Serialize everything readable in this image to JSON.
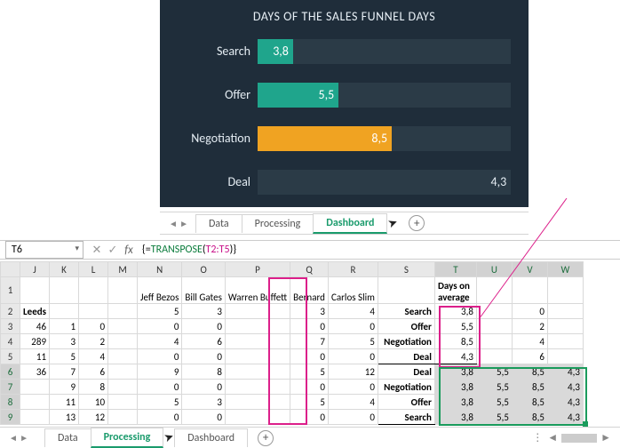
{
  "chart_data": {
    "type": "bar",
    "title": "DAYS OF THE SALES FUNNEL DAYS",
    "categories": [
      "Search",
      "Offer",
      "Negotiation",
      "Deal"
    ],
    "values": [
      3.8,
      5.5,
      8.5,
      4.3
    ],
    "value_labels": [
      "3,8",
      "5,5",
      "8,5",
      "4,3"
    ],
    "colors": [
      "#1fa58c",
      "#1fa58c",
      "#f0a322",
      "#2b3b47"
    ],
    "bar_width_pct": [
      14,
      32,
      53,
      100
    ],
    "value_outside": [
      false,
      false,
      false,
      true
    ],
    "xlabel": "",
    "ylabel": ""
  },
  "tabs": {
    "t1": "Data",
    "t2": "Processing",
    "t3": "Dashboard",
    "plus": "+"
  },
  "formula_bar": {
    "name_box": "T6",
    "cancel": "✕",
    "confirm": "✓",
    "fx": "fx",
    "prefix": "{=",
    "fn": "TRANSPOSE",
    "open": "(",
    "range": "T2:T5",
    "close": ")}"
  },
  "headers": {
    "J": "J",
    "K": "K",
    "L": "L",
    "M": "M",
    "N": "N",
    "O": "O",
    "P": "P",
    "Q": "Q",
    "R": "R",
    "S": "S",
    "T": "T",
    "U": "U",
    "V": "V",
    "W": "W"
  },
  "row_labels": [
    "1",
    "2",
    "3",
    "4",
    "5",
    "6",
    "7",
    "8",
    "9"
  ],
  "row1": {
    "N": "Jeff Bezos",
    "O": "Bill Gates",
    "P": "Warren Buffett",
    "Q": "Bernard",
    "R": "Carlos Slim",
    "T": "Days on average"
  },
  "row2": {
    "J": "Leeds",
    "N": "5",
    "O": "3",
    "Q": "3",
    "R": "4",
    "S": "Search",
    "T": "3,8",
    "V": "0"
  },
  "row3": {
    "J": "46",
    "K": "1",
    "L": "0",
    "N": "0",
    "O": "0",
    "Q": "0",
    "R": "0",
    "S": "Offer",
    "T": "5,5",
    "V": "2"
  },
  "row4": {
    "J": "289",
    "K": "3",
    "L": "2",
    "N": "4",
    "O": "6",
    "Q": "7",
    "R": "5",
    "S": "Negotiation",
    "T": "8,5",
    "V": "4"
  },
  "row5": {
    "J": "11",
    "K": "5",
    "L": "4",
    "N": "0",
    "O": "0",
    "Q": "0",
    "R": "0",
    "S": "Deal",
    "T": "4,3",
    "V": "6"
  },
  "row6": {
    "J": "36",
    "K": "7",
    "L": "6",
    "N": "9",
    "O": "8",
    "Q": "5",
    "R": "12",
    "S": "Deal",
    "T": "3,8",
    "U": "5,5",
    "V": "8,5",
    "W": "4,3"
  },
  "row7": {
    "K": "9",
    "L": "8",
    "N": "0",
    "O": "0",
    "Q": "0",
    "R": "0",
    "S": "Negotiation",
    "T": "3,8",
    "U": "5,5",
    "V": "8,5",
    "W": "4,3"
  },
  "row8": {
    "K": "11",
    "L": "10",
    "N": "5",
    "O": "3",
    "Q": "5",
    "R": "4",
    "S": "Offer",
    "T": "3,8",
    "U": "5,5",
    "V": "8,5",
    "W": "4,3"
  },
  "row9": {
    "K": "13",
    "L": "12",
    "N": "0",
    "O": "0",
    "Q": "0",
    "R": "0",
    "S": "Search",
    "T": "3,8",
    "U": "5,5",
    "V": "8,5",
    "W": "4,3"
  }
}
